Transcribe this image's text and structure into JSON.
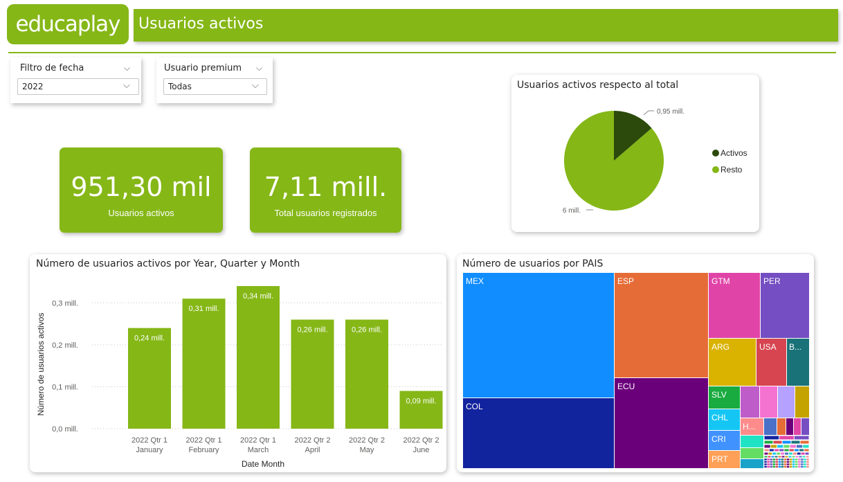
{
  "header": {
    "logo_text": "educaplay",
    "title": "Usuarios activos",
    "brand_color": "#85b717"
  },
  "filters": [
    {
      "label": "Filtro de fecha",
      "value": "2022",
      "icon": "chevron-down-icon"
    },
    {
      "label": "Usuario premium",
      "value": "Todas",
      "icon": "chevron-down-icon"
    }
  ],
  "kpis": [
    {
      "value": "951,30 mil",
      "label": "Usuarios activos"
    },
    {
      "value": "7,11 mill.",
      "label": "Total usuarios registrados"
    }
  ],
  "pie": {
    "title": "Usuarios activos respecto al total",
    "legend": [
      {
        "name": "Activos",
        "color": "#2b4a0b"
      },
      {
        "name": "Resto",
        "color": "#85b717"
      }
    ],
    "labels": {
      "activos": "0,95 mill.",
      "resto": "6 mill."
    }
  },
  "bar_chart": {
    "title": "Número de usuarios activos por Year, Quarter y Month",
    "ylabel": "Número de usuarios activos",
    "xlabel": "Date Month",
    "yticks": [
      "0,0 mill.",
      "0,1 mill.",
      "0,2 mill.",
      "0,3 mill."
    ],
    "bar_color": "#85b717"
  },
  "treemap": {
    "title": "Número de usuarios por PAIS",
    "labels": [
      "MEX",
      "ESP",
      "GTM",
      "PER",
      "ARG",
      "USA",
      "B...",
      "ECU",
      "COL",
      "SLV",
      "CHL",
      "H...",
      "CRI",
      "PRT"
    ]
  },
  "chart_data": [
    {
      "type": "pie",
      "title": "Usuarios activos respecto al total",
      "labels": [
        "Activos",
        "Resto"
      ],
      "values": [
        0.95,
        6.0
      ],
      "value_labels": [
        "0,95 mill.",
        "6 mill."
      ],
      "colors": [
        "#2b4a0b",
        "#85b717"
      ],
      "legend": "right"
    },
    {
      "type": "bar",
      "title": "Número de usuarios activos por Year, Quarter y Month",
      "categories": [
        "2022 Qtr 1 January",
        "2022 Qtr 1 February",
        "2022 Qtr 1 March",
        "2022 Qtr 2 April",
        "2022 Qtr 2 May",
        "2022 Qtr 2 June"
      ],
      "category_lines": [
        [
          "2022 Qtr 1",
          "January"
        ],
        [
          "2022 Qtr 1",
          "February"
        ],
        [
          "2022 Qtr 1",
          "March"
        ],
        [
          "2022 Qtr 2",
          "April"
        ],
        [
          "2022 Qtr 2",
          "May"
        ],
        [
          "2022 Qtr 2",
          "June"
        ]
      ],
      "values": [
        0.24,
        0.31,
        0.34,
        0.26,
        0.26,
        0.09
      ],
      "value_labels": [
        "0,24 mill.",
        "0,31 mill.",
        "0,34 mill.",
        "0,26 mill.",
        "0,26 mill.",
        "0,09 mill."
      ],
      "xlabel": "Date Month",
      "ylabel": "Número de usuarios activos",
      "ylim": [
        0,
        0.35
      ],
      "grid": true
    },
    {
      "type": "treemap",
      "title": "Número de usuarios por PAIS",
      "categories": [
        "MEX",
        "ESP",
        "GTM",
        "PER",
        "ARG",
        "USA",
        "B...",
        "ECU",
        "COL",
        "SLV",
        "CHL",
        "H...",
        "CRI",
        "PRT"
      ]
    }
  ]
}
